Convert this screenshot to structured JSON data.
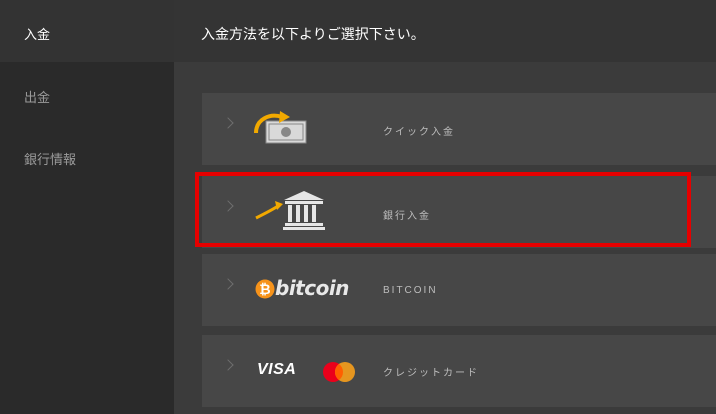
{
  "sidebar": {
    "items": [
      {
        "label": "入金",
        "active": true
      },
      {
        "label": "出金",
        "active": false
      },
      {
        "label": "銀行情報",
        "active": false
      }
    ]
  },
  "main": {
    "title": "入金方法を以下よりご選択下さい。",
    "methods": [
      {
        "label": "クイック入金",
        "icon": "quick-deposit-icon"
      },
      {
        "label": "銀行入金",
        "icon": "bank-icon",
        "highlighted": true
      },
      {
        "label": "BITCOIN",
        "icon": "bitcoin-logo",
        "logo_text": "bitcoin"
      },
      {
        "label": "クレジットカード",
        "icon": "visa-mastercard-logo",
        "logo_text": "VISA"
      }
    ]
  },
  "colors": {
    "highlight": "#e60000",
    "bitcoin_orange": "#f7931a",
    "arrow_orange": "#f2a900",
    "mastercard_red": "#eb001b",
    "mastercard_orange": "#f79e1b"
  }
}
